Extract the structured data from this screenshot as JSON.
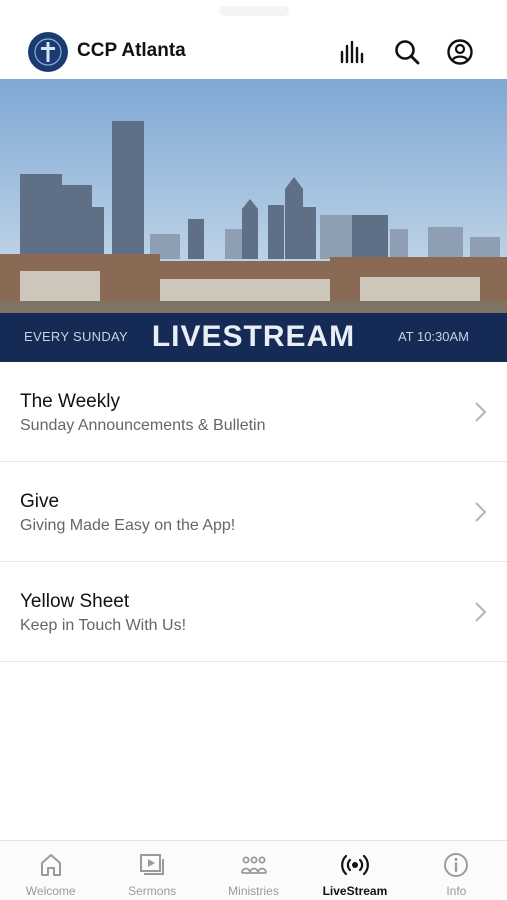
{
  "app": {
    "title": "CCP Atlanta"
  },
  "header_icons": [
    "equalizer-icon",
    "search-icon",
    "account-icon"
  ],
  "banner": {
    "left_text": "EVERY SUNDAY",
    "main_text": "LIVESTREAM",
    "right_text": "AT 10:30AM",
    "strip_color": "#152a55"
  },
  "list": [
    {
      "title": "The Weekly",
      "subtitle": "Sunday Announcements & Bulletin"
    },
    {
      "title": "Give",
      "subtitle": "Giving Made Easy on the App!"
    },
    {
      "title": "Yellow Sheet",
      "subtitle": "Keep in Touch With Us!"
    }
  ],
  "tabs": [
    {
      "label": "Welcome",
      "icon": "home-icon"
    },
    {
      "label": "Sermons",
      "icon": "video-library-icon"
    },
    {
      "label": "Ministries",
      "icon": "group-icon"
    },
    {
      "label": "LiveStream",
      "icon": "broadcast-icon",
      "active": true
    },
    {
      "label": "Info",
      "icon": "info-icon"
    }
  ],
  "colors": {
    "brand_navy": "#1b3a72",
    "active_tab": "#111111",
    "inactive_tab": "#9a9a9a"
  }
}
